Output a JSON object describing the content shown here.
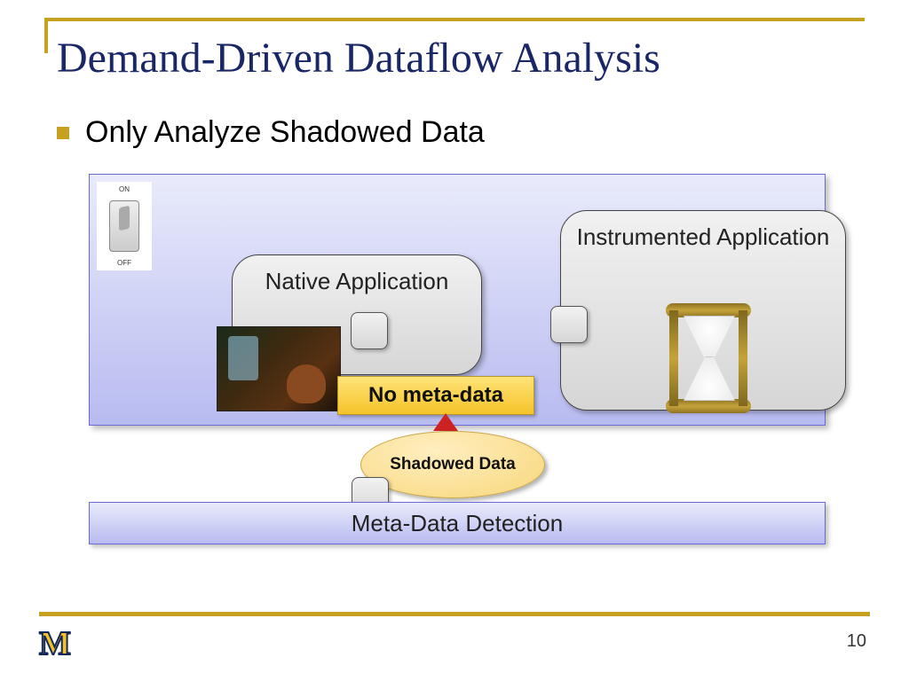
{
  "title": "Demand-Driven Dataflow Analysis",
  "bullet": "Only Analyze Shadowed Data",
  "switch": {
    "on": "ON",
    "off": "OFF"
  },
  "boxes": {
    "native": "Native Application",
    "instrumented": "Instrumented Application"
  },
  "no_meta": "No meta-data",
  "shadowed": "Shadowed Data",
  "detection_bar": "Meta-Data Detection",
  "page_number": "10",
  "logo_text": "M"
}
